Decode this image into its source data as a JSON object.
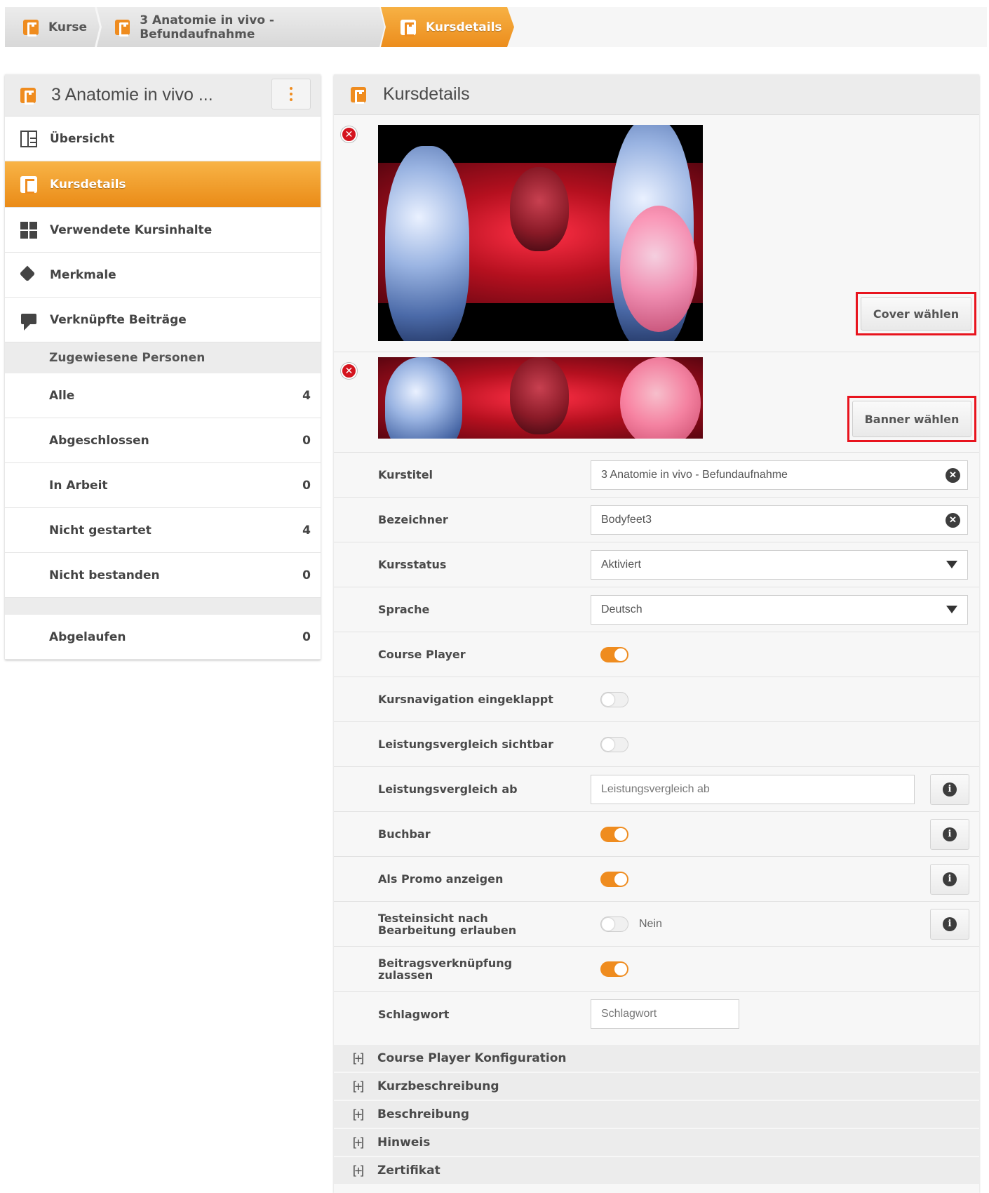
{
  "breadcrumb": {
    "items": [
      "Kurse",
      "3 Anatomie in vivo - Befundaufnahme",
      "Kursdetails"
    ]
  },
  "sidebar": {
    "title": "3 Anatomie in vivo ...",
    "nav": [
      {
        "label": "Übersicht",
        "icon": "overview-icon"
      },
      {
        "label": "Kursdetails",
        "icon": "course-icon",
        "active": true
      },
      {
        "label": "Verwendete Kursinhalte",
        "icon": "content-icon"
      },
      {
        "label": "Merkmale",
        "icon": "tag-icon"
      },
      {
        "label": "Verknüpfte Beiträge",
        "icon": "comment-icon"
      }
    ],
    "assigned_header": "Zugewiesene Personen",
    "counts": [
      {
        "label": "Alle",
        "value": "4"
      },
      {
        "label": "Abgeschlossen",
        "value": "0"
      },
      {
        "label": "In Arbeit",
        "value": "0"
      },
      {
        "label": "Nicht gestartet",
        "value": "4"
      },
      {
        "label": "Nicht bestanden",
        "value": "0"
      }
    ],
    "expired": {
      "label": "Abgelaufen",
      "value": "0"
    }
  },
  "main": {
    "title": "Kursdetails",
    "cover_button": "Cover wählen",
    "banner_button": "Banner wählen",
    "fields": {
      "kurstitel": {
        "label": "Kurstitel",
        "value": "3 Anatomie in vivo - Befundaufnahme"
      },
      "bezeichner": {
        "label": "Bezeichner",
        "value": "Bodyfeet3"
      },
      "kursstatus": {
        "label": "Kursstatus",
        "value": "Aktiviert"
      },
      "sprache": {
        "label": "Sprache",
        "value": "Deutsch"
      },
      "course_player": {
        "label": "Course Player",
        "on": true
      },
      "kursnavigation": {
        "label": "Kursnavigation eingeklappt",
        "on": false
      },
      "leistungsvergleich_sichtbar": {
        "label": "Leistungsvergleich sichtbar",
        "on": false
      },
      "leistungsvergleich_ab": {
        "label": "Leistungsvergleich ab",
        "placeholder": "Leistungsvergleich ab"
      },
      "buchbar": {
        "label": "Buchbar",
        "on": true
      },
      "promo": {
        "label": "Als Promo anzeigen",
        "on": true
      },
      "testeinsicht": {
        "label": "Testeinsicht nach Bearbeitung erlauben",
        "on": false,
        "state_text": "Nein"
      },
      "beitragsverknuepfung": {
        "label": "Beitragsverknüpfung zulassen",
        "on": true
      },
      "schlagwort": {
        "label": "Schlagwort",
        "placeholder": "Schlagwort"
      }
    },
    "accordions": [
      "Course Player Konfiguration",
      "Kurzbeschreibung",
      "Beschreibung",
      "Hinweis",
      "Zertifikat"
    ]
  },
  "colors": {
    "accent": "#ef8c1f",
    "highlight": "#e8141e",
    "delete": "#d4141e"
  }
}
